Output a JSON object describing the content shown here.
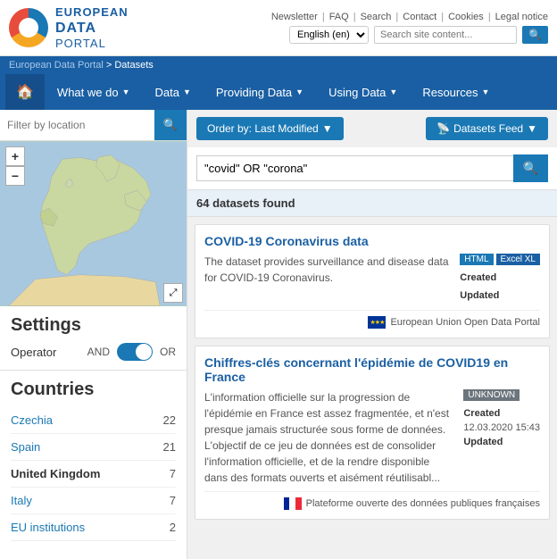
{
  "header": {
    "logo_line1": "EUROPEAN",
    "logo_line2": "DATA",
    "logo_line3": "PORTAL",
    "top_links": [
      "Newsletter",
      "FAQ",
      "Search",
      "Contact",
      "Cookies",
      "Legal notice"
    ],
    "lang_select": "English (en)",
    "search_placeholder": "Search site content..."
  },
  "breadcrumb": {
    "portal_link": "European Data Portal",
    "separator": " > ",
    "current": "Datasets"
  },
  "nav": {
    "home_label": "🏠",
    "items": [
      {
        "label": "What we do",
        "has_caret": true
      },
      {
        "label": "Data",
        "has_caret": true
      },
      {
        "label": "Providing Data",
        "has_caret": true
      },
      {
        "label": "Using Data",
        "has_caret": true
      },
      {
        "label": "Resources",
        "has_caret": true
      }
    ]
  },
  "sidebar": {
    "filter_placeholder": "Filter by location",
    "settings_title": "Settings",
    "operator_label": "Operator",
    "and_label": "AND",
    "or_label": "OR",
    "countries_title": "Countries",
    "countries": [
      {
        "name": "Czechia",
        "count": 22
      },
      {
        "name": "Spain",
        "count": 21
      },
      {
        "name": "United Kingdom",
        "count": 7
      },
      {
        "name": "Italy",
        "count": 7
      },
      {
        "name": "EU institutions",
        "count": 2
      }
    ]
  },
  "content": {
    "order_btn": "Order by: Last Modified",
    "feed_btn": "Datasets Feed",
    "search_query": "\"covid\" OR \"corona\"",
    "results_count": "64 datasets found",
    "datasets": [
      {
        "title": "COVID-19 Coronavirus data",
        "description": "The dataset provides surveillance and disease data for COVID-19 Coronavirus.",
        "badges": [
          "HTML",
          "Excel XL"
        ],
        "meta_created_label": "Created",
        "meta_created_value": "",
        "meta_updated_label": "Updated",
        "meta_updated_value": "",
        "source": "European Union Open Data Portal",
        "source_flag": "eu"
      },
      {
        "title": "Chiffres-clés concernant l'épidémie de COVID19 en France",
        "description": "L'information officielle sur la progression de l'épidémie en France est assez fragmentée, et n'est presque jamais structurée sous forme de données. L'objectif de ce jeu de données est de consolider l'information officielle, et de la rendre disponible dans des formats ouverts et aisément réutilisabl...",
        "badges": [
          "UNKNOWN"
        ],
        "meta_created_label": "Created",
        "meta_created_value": "12.03.2020 15:43",
        "meta_updated_label": "Updated",
        "meta_updated_value": "",
        "source": "Plateforme ouverte des données publiques françaises",
        "source_flag": "fr"
      }
    ]
  }
}
